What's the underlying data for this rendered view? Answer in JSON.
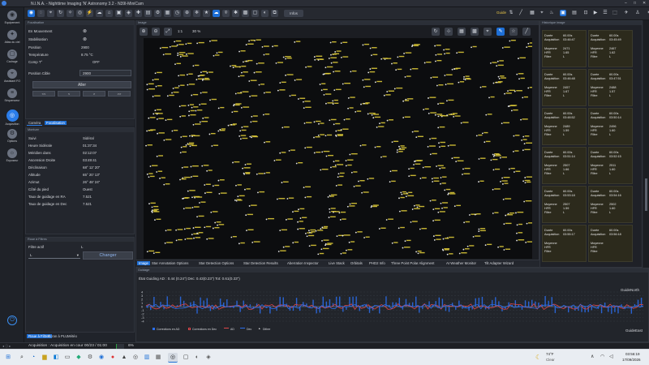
{
  "window": {
    "title": "N.I.N.A. - Nighttime Imaging 'N' Astronomy 3.2 - N39I-MiniCam"
  },
  "toolbar": {
    "guide_label": "Guide",
    "infos_label": "Infos"
  },
  "nav": [
    {
      "label": "Equipement",
      "icon": "camera-icon"
    },
    {
      "label": "Atlas du ciel",
      "icon": "atlas-icon"
    },
    {
      "label": "Cadrage",
      "icon": "frame-icon"
    },
    {
      "label": "Assistant FO",
      "icon": "focus-icon"
    },
    {
      "label": "Séquenceur",
      "icon": "sequencer-icon"
    },
    {
      "label": "Acquisition",
      "icon": "aperture-icon"
    },
    {
      "label": "Options",
      "icon": "gear-icon"
    },
    {
      "label": "Exposeur",
      "icon": "exposure-icon"
    }
  ],
  "focuser": {
    "header": "Focalisation",
    "rows": [
      {
        "label": "En Mouvement",
        "value": "⊗"
      },
      {
        "label": "Stabilisation",
        "value": "⊗"
      },
      {
        "label": "Position",
        "value": "2900"
      },
      {
        "label": "Température",
        "value": "8.75 °C"
      },
      {
        "label": "Comp T°",
        "value": "OFF"
      }
    ],
    "target_label": "Position Cible",
    "target_value": "2900",
    "go_label": "Aller",
    "steps": [
      "<<",
      "<",
      ">",
      ">>"
    ]
  },
  "cam_tabs": [
    "Caméra",
    "Focalisation"
  ],
  "mount": {
    "header": "Monture",
    "rows": [
      {
        "label": "Suivi",
        "value": "Sidéral"
      },
      {
        "label": "Heure Sidérale",
        "value": "01:37:34"
      },
      {
        "label": "Méridien dans",
        "value": "02:12:07"
      },
      {
        "label": "Ascension Droite",
        "value": "03:49:41"
      },
      {
        "label": "Déclinaison",
        "value": "68° 12' 20\""
      },
      {
        "label": "Altitude",
        "value": "65° 20' 13\""
      },
      {
        "label": "Azimut",
        "value": "26° 48' 24\""
      },
      {
        "label": "Côté du pied",
        "value": "Ouest"
      },
      {
        "label": "Taux de guidage en RA",
        "value": "7.521"
      },
      {
        "label": "Taux de guidage en Dec",
        "value": "7.521"
      }
    ]
  },
  "filter": {
    "header": "Roue à Filtres",
    "active_label": "Filtre actif",
    "active_value": "L",
    "select_value": "L",
    "change_label": "Changer"
  },
  "bottom_left_tabs": [
    "Roue à Filtres",
    "Écran à PLU",
    "Météo"
  ],
  "image": {
    "header": "Image",
    "zoom": "30 %",
    "ratio": "1:1"
  },
  "image_tabs": [
    "Image",
    "Star Annotation Options",
    "Star Detection Options",
    "Star Detection Results",
    "Aberration Inspector",
    "Live Stack",
    "Orbitals",
    "PHD2 Info",
    "Three Point Polar Alignment",
    "AI Weather Monitor",
    "Tilt Adapter Wizard"
  ],
  "history": {
    "header": "Historique image",
    "labels": {
      "duration": "Durée",
      "acq": "Acquisition",
      "mean": "Moyenne",
      "hfr": "HFR",
      "filter": "Filtre"
    },
    "items": [
      {
        "d": "60.00s",
        "a": "03:46:47",
        "m": "2471",
        "h": "1.65",
        "f": "L"
      },
      {
        "d": "60.00s",
        "a": "03:45:49",
        "m": "2467",
        "h": "1.62",
        "f": "L"
      },
      {
        "d": "60.00s",
        "a": "03:46:48",
        "m": "2457",
        "h": "1.67",
        "f": "L"
      },
      {
        "d": "60.00s",
        "a": "03:47:51",
        "m": "2488",
        "h": "1.57",
        "f": "L"
      },
      {
        "d": "60.00s",
        "a": "03:48:52",
        "m": "2489",
        "h": "1.59",
        "f": "L"
      },
      {
        "d": "60.00s",
        "a": "03:50:14",
        "m": "2496",
        "h": "1.60",
        "f": "L"
      },
      {
        "d": "60.00s",
        "a": "03:51:14",
        "m": "2507",
        "h": "1.66",
        "f": "L"
      },
      {
        "d": "60.00s",
        "a": "03:52:15",
        "m": "2511",
        "h": "1.60",
        "f": "L"
      },
      {
        "d": "60.00s",
        "a": "03:53:18",
        "m": "2507",
        "h": "1.59",
        "f": "L"
      },
      {
        "d": "60.00s",
        "a": "03:54:16",
        "m": "2502",
        "h": "1.60",
        "f": "L"
      },
      {
        "d": "60.00s",
        "a": "03:55:17",
        "m": "",
        "h": "",
        "f": ""
      },
      {
        "d": "60.00s",
        "a": "03:56:18",
        "m": "",
        "h": "",
        "f": ""
      }
    ]
  },
  "guiding": {
    "header": "Guidage",
    "state": "État Guiding  AD : 0.44 (0.24\")  Dec: 0.43(0.23\")  Tot: 0.61(0.33\")",
    "north": "GuideNorth",
    "east": "GuideEast",
    "yticks": [
      "4",
      "3",
      "2",
      "1",
      "0",
      "-1",
      "-2",
      "-3",
      "-4"
    ],
    "legend": [
      "Corrections en AD",
      "Corrections en Dec",
      "AD",
      "Dec",
      "Dither"
    ],
    "colors": {
      "ra": "#e0464a",
      "dec": "#2a6ff0"
    }
  },
  "status": {
    "acq_label": "Acquisition :",
    "acq_text": "Acquisition en cour 00/23 / 01:00",
    "percent": "6%",
    "progress": 0.06
  },
  "taskbar": {
    "weather_temp": "74°F",
    "weather_text": "Clear",
    "time": "03:56:19",
    "date": "17/09/2026"
  },
  "colors": {
    "accent": "#1e6fd6",
    "annot": "#e6d23a"
  }
}
